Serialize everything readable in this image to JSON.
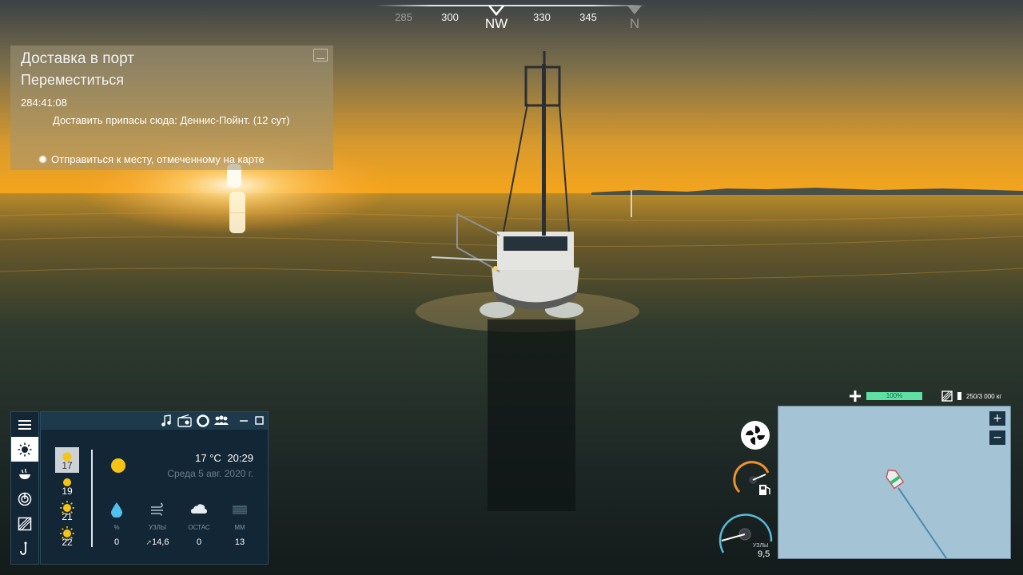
{
  "compass": {
    "ticks": [
      "285",
      "300",
      "330",
      "345"
    ],
    "heading": "NW",
    "next": "N"
  },
  "objective": {
    "title": "Доставка в порт",
    "subtitle": "Переместиться",
    "timer": "284:41:08",
    "task": "Доставить припасы сюда: Деннис-Пойнт. (12 сут)",
    "step": "Отправиться к месту, отмеченному на карте"
  },
  "weather": {
    "days": [
      "17",
      "19",
      "21",
      "22"
    ],
    "temperature": "17 °C",
    "time": "20:29",
    "date": "Среда  5 авг. 2020 г.",
    "stats": [
      {
        "label": "%",
        "value": "0",
        "icon": "raindrop-icon"
      },
      {
        "label": "УЗЛЫ",
        "value": "14,6",
        "icon": "wind-icon"
      },
      {
        "label": "ОСТАС",
        "value": "0",
        "icon": "cloud-icon"
      },
      {
        "label": "ММ",
        "value": "13",
        "icon": "rain-gauge-icon"
      }
    ]
  },
  "hud": {
    "health_value": "100%",
    "health_fraction": 1.0,
    "cargo": "250/3 000 кг",
    "speed_label": "УЗЛЫ",
    "speed_value": "9,5"
  },
  "minimap": {
    "zoom_in": "+",
    "zoom_out": "−"
  }
}
